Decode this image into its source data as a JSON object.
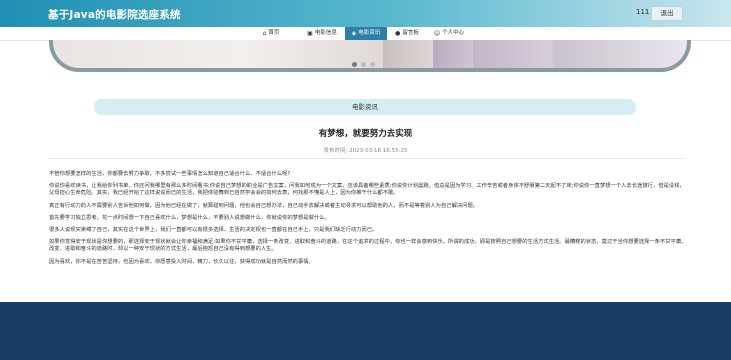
{
  "header": {
    "site_title": "基于Java的电影院选座系统",
    "user_name": "111",
    "logout_label": "退出"
  },
  "nav": {
    "items": [
      {
        "icon": "home-icon",
        "label": "首页",
        "active": false
      },
      {
        "icon": "film-icon",
        "label": "电影信息",
        "active": false
      },
      {
        "icon": "news-icon",
        "label": "电影资讯",
        "active": true
      },
      {
        "icon": "help-icon",
        "label": "留言板",
        "active": false
      },
      {
        "icon": "user-icon",
        "label": "个人中心",
        "active": false
      }
    ]
  },
  "carousel": {
    "slide_count": 3,
    "active_index": 0
  },
  "section": {
    "label": "电影资讯"
  },
  "article": {
    "title": "有梦想，就要努力去实现",
    "time_label": "发布时间:",
    "time_value": "2023-03-16 16:55:25",
    "paragraphs": [
      "不管你想要怎样的生活，你都要去努力争取，不多尝试一些事情怎么知道自己适合什么、不适合什么呢?",
      "你说你喜欢读书，让我给你列书单，你还问我哪里有那么多时间看书;你说自己梦想的职业是广告文案，问我如何成为一个文案，应该具备哪些素质;你说你计划晨跑，但总是因为学习、工作辛苦或者身体不舒服第二天起不了床;你说你一直梦想一个人去长途旅行，但是没钱，父母担心生命危险。其实，我已经开始了这样说说而已的生活，我把体验舞到已自然学会会的如何去表，何找那不懂是人上，因为你推干什么都不敢。",
      "真正有行动力的人不需要别人告诉他如何做，因为他已经在做了，就算碰到问题，他也会自己想办法，自己动手去解决或者主动寻求可以帮助他的人，而不是等着别人为自己解决问题。",
      "首先要学习独立思考。花一点时间想一下自己喜欢什么，梦想是什么，不要别人说想做什么，你就说你的梦想是做什么。",
      "很多人说现实束缚了自己，其实在这个世界上，我们一直都可以有很多选择，生活的决定权也一直都在自己手上，只是我们缺乏行动力而已。",
      "如果你觉得安于现状是你想要的，那选择安于现状就会让你幸福和满足;如果你不甘平庸，选择一条改变、进取和奋斗的道路，在这个追求的过程中，你也一样会感到快乐。所谓的成功，即是按照自己想要的生活方式生活。最糟糕的状态，莫过于当你想要选择一条不甘平庸、改变、进取和奋斗的道路时，却以一种安于现状的方式生活，最后抱怨自己没有得到想要的人生。",
      "因为喜欢，你不是在苦苦坚持，也因为喜欢，你愿意投入时间、精力，长久以往，获得成功就是自然而然的事情。"
    ]
  },
  "colors": {
    "header_gradient_start": "#1f8fb3",
    "nav_active": "#2e7fa5",
    "section_pill": "#d5eef4",
    "footer": "#173d64"
  }
}
